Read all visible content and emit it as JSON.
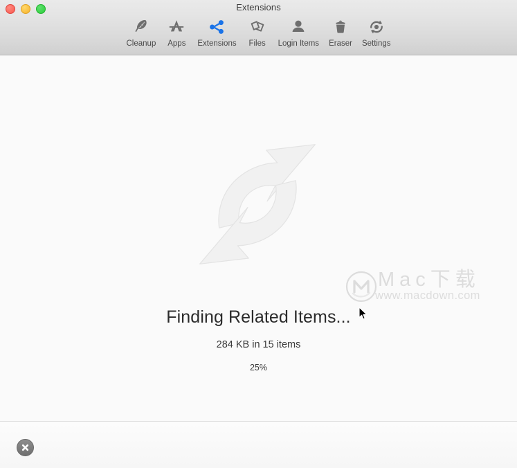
{
  "window": {
    "title": "Extensions",
    "traffic_lights": [
      {
        "name": "close",
        "color": "#f9584e"
      },
      {
        "name": "minimize",
        "color": "#f7b32b"
      },
      {
        "name": "maximize",
        "color": "#2bcd3a"
      }
    ]
  },
  "toolbar": {
    "items": [
      {
        "label": "Cleanup",
        "icon": "feather-icon",
        "active": false,
        "color": "#6e6e6e"
      },
      {
        "label": "Apps",
        "icon": "appstore-icon",
        "active": false,
        "color": "#6e6e6e"
      },
      {
        "label": "Extensions",
        "icon": "share-nodes-icon",
        "active": true,
        "color": "#1a73e8"
      },
      {
        "label": "Files",
        "icon": "files-icon",
        "active": false,
        "color": "#6e6e6e"
      },
      {
        "label": "Login Items",
        "icon": "person-icon",
        "active": false,
        "color": "#6e6e6e"
      },
      {
        "label": "Eraser",
        "icon": "trash-icon",
        "active": false,
        "color": "#6e6e6e"
      },
      {
        "label": "Settings",
        "icon": "gear-sync-icon",
        "active": false,
        "color": "#6e6e6e"
      }
    ]
  },
  "main": {
    "spinner_icon": "circular-arrows-icon",
    "status_title": "Finding Related Items...",
    "status_subtitle": "284 KB in 15 items",
    "progress_percent": "25%"
  },
  "watermark": {
    "logo": "macdown-circle-m-logo",
    "text": "Mac下载",
    "url": "www.macdown.com"
  },
  "footer": {
    "cancel_icon": "close-circle-icon",
    "cancel_label": ""
  }
}
